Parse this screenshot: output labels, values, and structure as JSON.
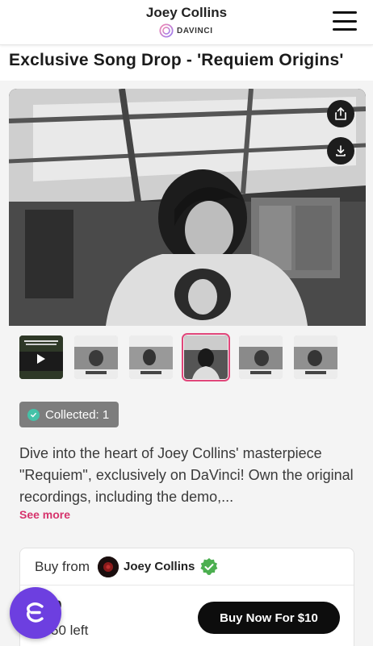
{
  "header": {
    "artist_name": "Joey Collins",
    "brand_name": "DAVINCI"
  },
  "page": {
    "title": "Exclusive Song Drop - 'Requiem Origins'"
  },
  "hero": {
    "share_icon": "share-icon",
    "download_icon": "download-icon"
  },
  "thumbnails": [
    {
      "type": "video",
      "caption": "SOLO RECORDING"
    },
    {
      "type": "image"
    },
    {
      "type": "image"
    },
    {
      "type": "image",
      "selected": true
    },
    {
      "type": "image"
    },
    {
      "type": "image"
    }
  ],
  "collected": {
    "label": "Collected: 1"
  },
  "description": {
    "text": "Dive into the heart of Joey Collins' masterpiece \"Requiem\", exclusively on DaVinci! Own the original recordings, including the demo,...",
    "see_more": "See more"
  },
  "purchase": {
    "buy_from_label": "Buy from",
    "seller_name": "Joey Collins",
    "price_number": "0",
    "left_text": "50 left",
    "buy_button": "Buy Now For $10"
  },
  "colors": {
    "accent_pink": "#d6336c",
    "fab_purple": "#6d3fe0",
    "verified_green": "#4caf50",
    "collected_check": "#44c2a8"
  }
}
